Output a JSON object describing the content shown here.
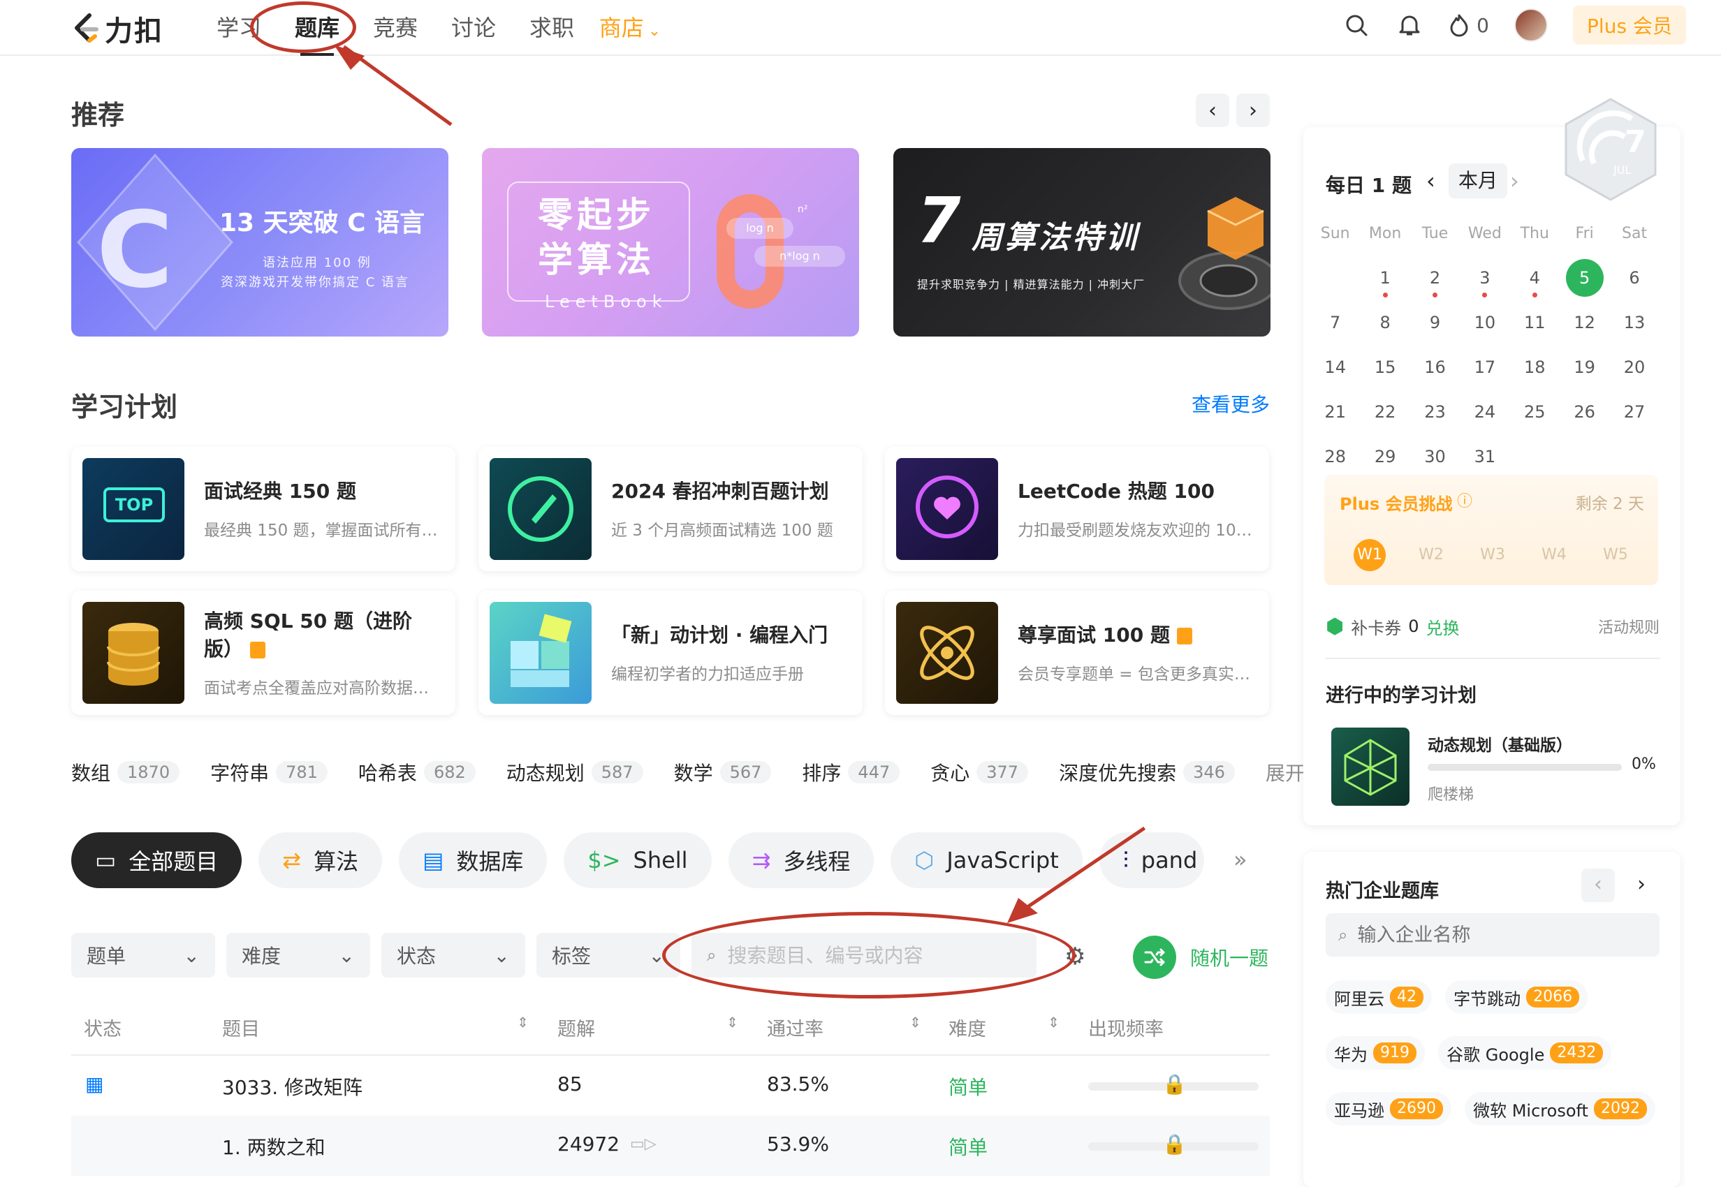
{
  "brand": {
    "name": "力扣"
  },
  "nav": {
    "items": [
      "学习",
      "题库",
      "竞赛",
      "讨论",
      "求职"
    ],
    "shop": "商店",
    "active": "题库"
  },
  "topbar": {
    "fire_count": "0",
    "plus_label": "Plus 会员"
  },
  "recommend": {
    "title": "推荐",
    "banners": [
      {
        "title": "13 天突破 C 语言",
        "sub1": "语法应用 100 例",
        "sub2": "资深游戏开发带你搞定 C 语言",
        "letter": "C"
      },
      {
        "title1": "零起步",
        "title2": "学算法",
        "sub": "LeetBook",
        "tag1": "log n",
        "tag2": "n*log n",
        "tag3": "n²"
      },
      {
        "num": "7",
        "title": "周算法特训",
        "sub": "提升求职竞争力 | 精进算法能力 | 冲刺大厂"
      }
    ]
  },
  "plans": {
    "title": "学习计划",
    "more": "查看更多",
    "items": [
      {
        "title": "面试经典 150 题",
        "desc": "最经典 150 题，掌握面试所有…",
        "locked": false,
        "icon_text": "TOP"
      },
      {
        "title": "2024 春招冲刺百题计划",
        "desc": "近 3 个月高频面试精选 100 题",
        "locked": false
      },
      {
        "title": "LeetCode 热题 100",
        "desc": "力扣最受刷题发烧友欢迎的 10…",
        "locked": false
      },
      {
        "title": "高频 SQL 50 题（进阶版）",
        "desc": "面试考点全覆盖应对高阶数据…",
        "locked": true
      },
      {
        "title": "「新」动计划 · 编程入门",
        "desc": "编程初学者的力扣适应手册",
        "locked": false
      },
      {
        "title": "尊享面试 100 题",
        "desc": "会员专享题单 = 包含更多真实…",
        "locked": true
      }
    ]
  },
  "tags": {
    "items": [
      {
        "name": "数组",
        "count": "1870"
      },
      {
        "name": "字符串",
        "count": "781"
      },
      {
        "name": "哈希表",
        "count": "682"
      },
      {
        "name": "动态规划",
        "count": "587"
      },
      {
        "name": "数学",
        "count": "567"
      },
      {
        "name": "排序",
        "count": "447"
      },
      {
        "name": "贪心",
        "count": "377"
      },
      {
        "name": "深度优先搜索",
        "count": "346"
      }
    ],
    "expand": "展开"
  },
  "categories": [
    "全部题目",
    "算法",
    "数据库",
    "Shell",
    "多线程",
    "JavaScript",
    "pand"
  ],
  "filters": {
    "list": "题单",
    "difficulty": "难度",
    "status": "状态",
    "tags": "标签",
    "search_placeholder": "搜索题目、编号或内容",
    "random": "随机一题"
  },
  "table": {
    "headers": [
      "状态",
      "题目",
      "题解",
      "通过率",
      "难度",
      "出现频率"
    ],
    "rows": [
      {
        "title": "3033. 修改矩阵",
        "solutions": "85",
        "rate": "83.5%",
        "difficulty": "简单",
        "daily": true
      },
      {
        "title": "1. 两数之和",
        "solutions": "24972",
        "rate": "53.9%",
        "difficulty": "简单",
        "daily": false
      }
    ]
  },
  "calendar": {
    "title": "每日 1 题",
    "month": "本月",
    "badge_day": "7",
    "badge_month": "JUL",
    "weekdays": [
      "Sun",
      "Mon",
      "Tue",
      "Wed",
      "Thu",
      "Fri",
      "Sat"
    ],
    "weeks": [
      [
        "",
        "1",
        "2",
        "3",
        "4",
        "5",
        "6"
      ],
      [
        "7",
        "8",
        "9",
        "10",
        "11",
        "12",
        "13"
      ],
      [
        "14",
        "15",
        "16",
        "17",
        "18",
        "19",
        "20"
      ],
      [
        "21",
        "22",
        "23",
        "24",
        "25",
        "26",
        "27"
      ],
      [
        "28",
        "29",
        "30",
        "31",
        "",
        "",
        ""
      ]
    ],
    "today": "5",
    "dotted_days": [
      "1",
      "2",
      "3",
      "4"
    ]
  },
  "plus_challenge": {
    "title": "Plus 会员挑战",
    "remaining": "剩余 2 天",
    "weeks": [
      "W1",
      "W2",
      "W3",
      "W4",
      "W5"
    ]
  },
  "voucher": {
    "label": "补卡券",
    "count": "0",
    "redeem": "兑换",
    "rules": "活动规则"
  },
  "ongoing": {
    "title": "进行中的学习计划",
    "plan": "动态规划（基础版）",
    "progress": "0%",
    "progress_value": 0,
    "stage": "爬楼梯"
  },
  "companies": {
    "title": "热门企业题库",
    "search_placeholder": "输入企业名称",
    "items": [
      {
        "name": "阿里云",
        "count": "42"
      },
      {
        "name": "字节跳动",
        "count": "2066"
      },
      {
        "name": "华为",
        "count": "919"
      },
      {
        "name": "谷歌 Google",
        "count": "2432"
      },
      {
        "name": "亚马逊",
        "count": "2690"
      },
      {
        "name": "微软 Microsoft",
        "count": "2092"
      }
    ]
  },
  "colors": {
    "brand_orange": "#ffa116",
    "easy_green": "#2db55d",
    "link_blue": "#007aff",
    "annotation_red": "#c0392b"
  }
}
